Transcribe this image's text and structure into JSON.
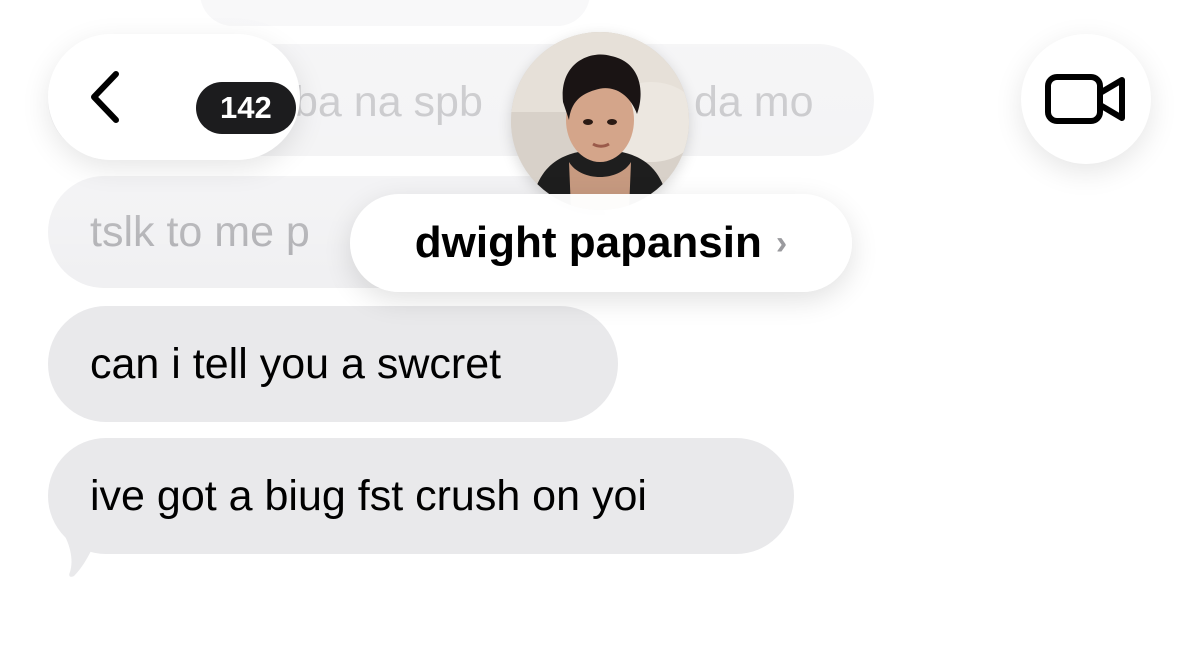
{
  "header": {
    "unread_count": "142",
    "contact_name": "dwight papansin",
    "back_icon": "chevron-left-icon",
    "video_icon": "video-camera-icon",
    "name_chevron": "›"
  },
  "messages": [
    {
      "text": "ba na spb",
      "text_tail": "da mo",
      "state": "obscured"
    },
    {
      "text": "tslk to me p",
      "state": "obscured"
    },
    {
      "text": "can i tell you a swcret",
      "state": "received"
    },
    {
      "text": "ive got a biug fst crush on yoi",
      "state": "received"
    }
  ],
  "colors": {
    "bubble_bg": "#e9e9eb",
    "badge_bg": "#1c1c1e",
    "background": "#ffffff"
  }
}
